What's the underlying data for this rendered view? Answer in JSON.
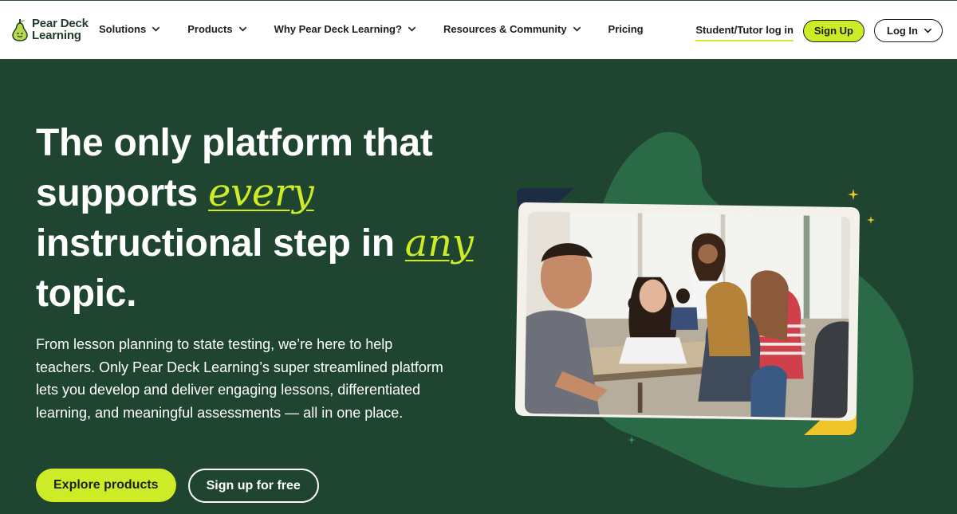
{
  "brand": {
    "name_line1": "Pear Deck",
    "name_line2": "Learning"
  },
  "nav": {
    "items": [
      {
        "label": "Solutions",
        "has_dropdown": true
      },
      {
        "label": "Products",
        "has_dropdown": true
      },
      {
        "label": "Why Pear Deck Learning?",
        "has_dropdown": true
      },
      {
        "label": "Resources & Community",
        "has_dropdown": true
      },
      {
        "label": "Pricing",
        "has_dropdown": false
      }
    ],
    "student_login": "Student/Tutor log in",
    "sign_up": "Sign Up",
    "log_in": "Log In"
  },
  "hero": {
    "title_part1": "The only platform that supports ",
    "title_accent1": "every",
    "title_part2": " instructional step in ",
    "title_accent2": "any",
    "title_part3": " topic.",
    "description": "From lesson planning to state testing, we’re here to help teachers. Only Pear Deck Learning’s super streamlined platform lets you develop and deliver engaging lessons, differentiated learning, and meaningful assessments — all in one place.",
    "primary_cta": "Explore products",
    "secondary_cta": "Sign up for free"
  },
  "colors": {
    "hero_bg": "#1f4530",
    "accent_lime": "#cdeb26",
    "blob_green": "#2b6a47",
    "corner_yellow": "#f0c52a",
    "corner_navy": "#1d2c45"
  },
  "icons": [
    "chevron-down-icon",
    "pear-logo-icon",
    "sparkle-icon"
  ]
}
